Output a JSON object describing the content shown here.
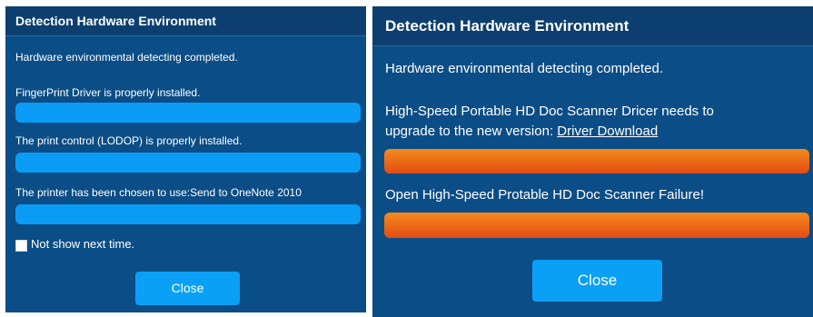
{
  "left_dialog": {
    "title": "Detection Hardware Environment",
    "status_text": "Hardware environmental detecting completed.",
    "items": [
      {
        "text": "FingerPrint Driver is properly installed.",
        "state": "ok"
      },
      {
        "text": "The print control (LODOP) is properly installed.",
        "state": "ok"
      },
      {
        "text": "The printer has been chosen to use:Send to OneNote 2010",
        "state": "ok"
      }
    ],
    "checkbox_label": "Not show next time.",
    "close_label": "Close"
  },
  "right_dialog": {
    "title": "Detection Hardware Environment",
    "status_text": "Hardware environmental detecting completed.",
    "items": [
      {
        "text_line1": "High-Speed Portable HD Doc Scanner Dricer needs to",
        "text_line2": "upgrade to the new version: ",
        "link_text": "Driver Download",
        "state": "fail"
      },
      {
        "text": "Open High-Speed Protable HD Doc Scanner Failure!",
        "state": "fail"
      }
    ],
    "close_label": "Close"
  },
  "colors": {
    "panel_bg": "#0b4d86",
    "header_bg": "#0c3f70",
    "ok_bar": "#0a9cf5",
    "fail_bar": "#e85a16",
    "button": "#0aa0f5"
  }
}
